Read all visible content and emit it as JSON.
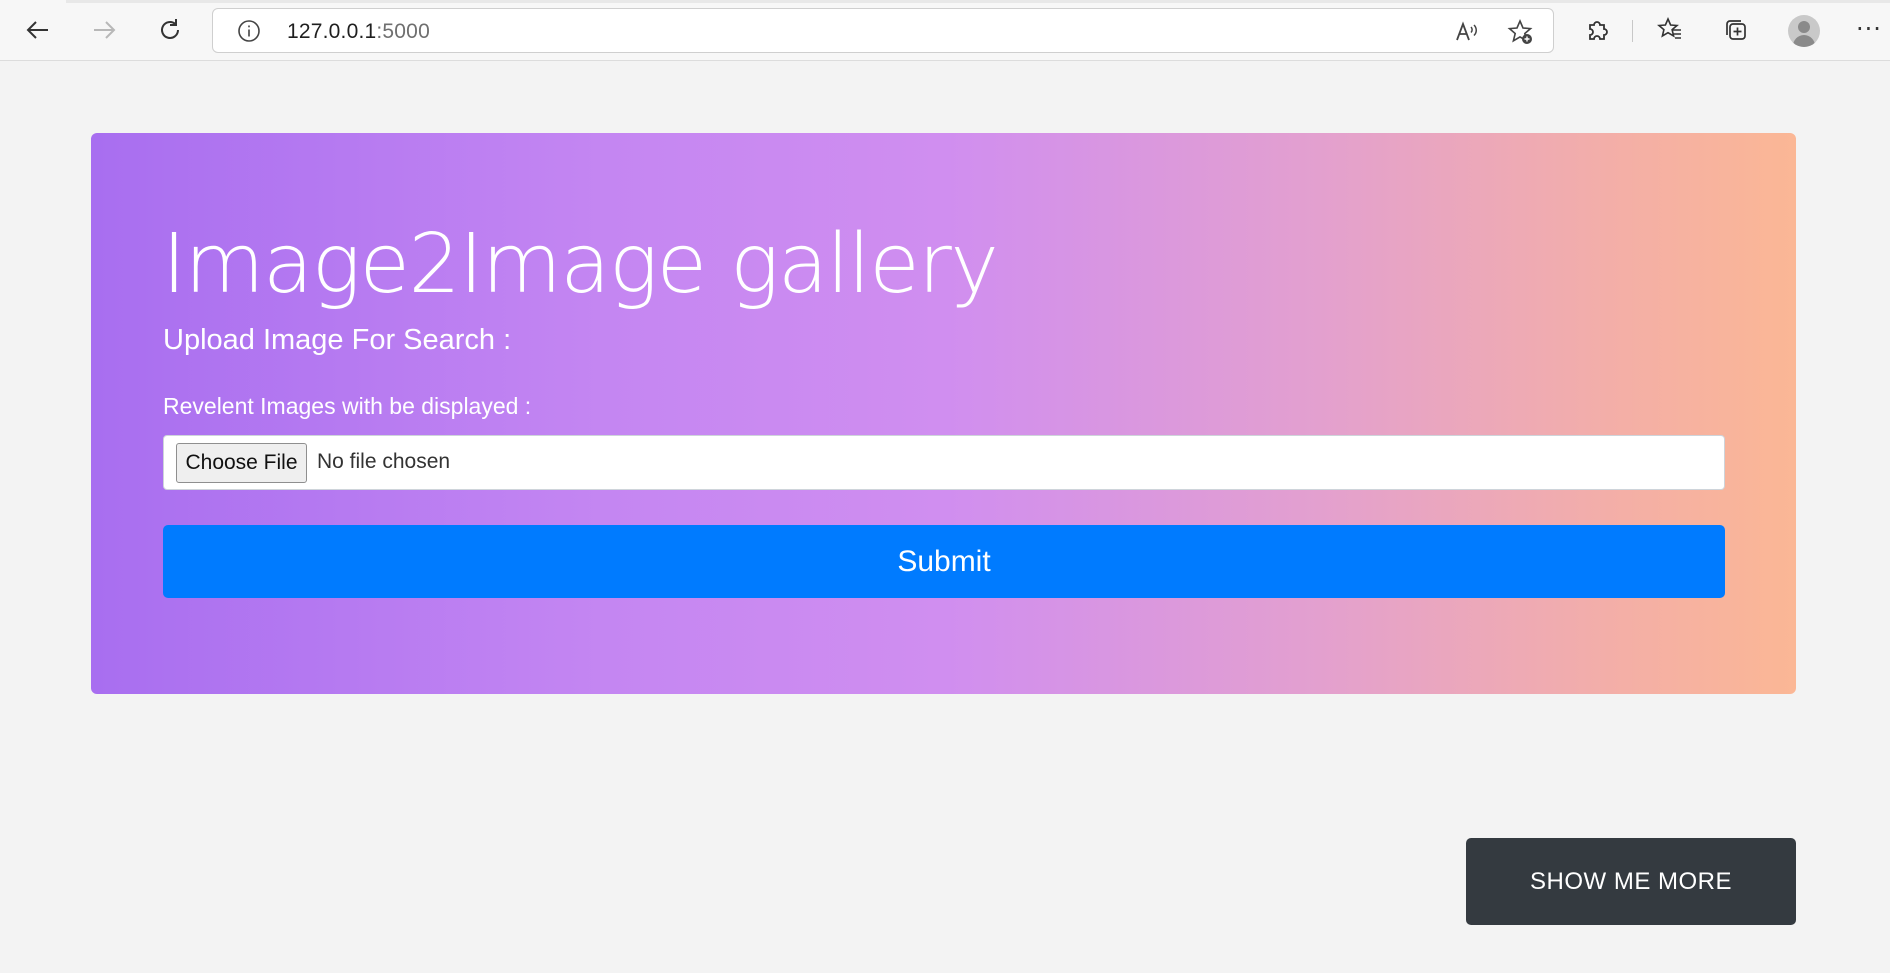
{
  "browser": {
    "url_host": "127.0.0.1",
    "url_port": ":5000"
  },
  "main": {
    "title": "Image2Image gallery",
    "subtitle": "Upload Image For Search :",
    "file_label": "Revelent Images with be displayed :",
    "choose_file_label": "Choose File",
    "file_status": "No file chosen",
    "submit_label": "Submit",
    "show_more_label": "SHOW ME MORE"
  },
  "colors": {
    "gradient_start": "#a86ef0",
    "gradient_end": "#fbb795",
    "submit": "#007bff",
    "show_more": "#343a40"
  }
}
